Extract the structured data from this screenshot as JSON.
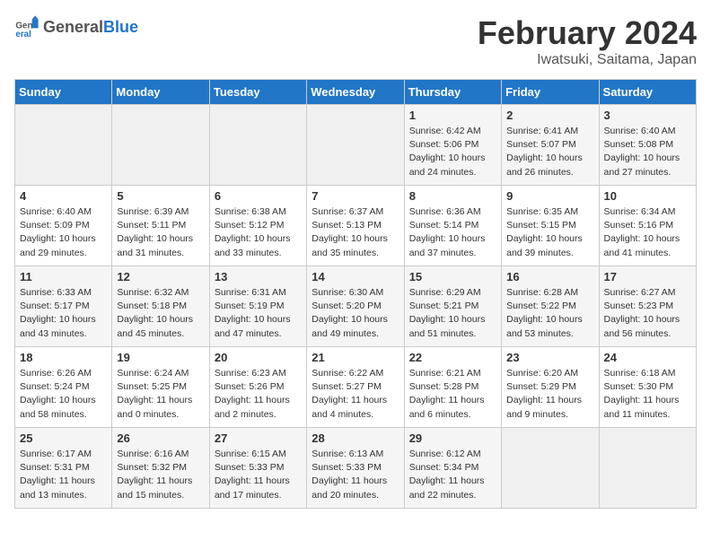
{
  "header": {
    "logo_general": "General",
    "logo_blue": "Blue",
    "month_year": "February 2024",
    "location": "Iwatsuki, Saitama, Japan"
  },
  "days_of_week": [
    "Sunday",
    "Monday",
    "Tuesday",
    "Wednesday",
    "Thursday",
    "Friday",
    "Saturday"
  ],
  "weeks": [
    [
      {
        "day": "",
        "info": ""
      },
      {
        "day": "",
        "info": ""
      },
      {
        "day": "",
        "info": ""
      },
      {
        "day": "",
        "info": ""
      },
      {
        "day": "1",
        "info": "Sunrise: 6:42 AM\nSunset: 5:06 PM\nDaylight: 10 hours\nand 24 minutes."
      },
      {
        "day": "2",
        "info": "Sunrise: 6:41 AM\nSunset: 5:07 PM\nDaylight: 10 hours\nand 26 minutes."
      },
      {
        "day": "3",
        "info": "Sunrise: 6:40 AM\nSunset: 5:08 PM\nDaylight: 10 hours\nand 27 minutes."
      }
    ],
    [
      {
        "day": "4",
        "info": "Sunrise: 6:40 AM\nSunset: 5:09 PM\nDaylight: 10 hours\nand 29 minutes."
      },
      {
        "day": "5",
        "info": "Sunrise: 6:39 AM\nSunset: 5:11 PM\nDaylight: 10 hours\nand 31 minutes."
      },
      {
        "day": "6",
        "info": "Sunrise: 6:38 AM\nSunset: 5:12 PM\nDaylight: 10 hours\nand 33 minutes."
      },
      {
        "day": "7",
        "info": "Sunrise: 6:37 AM\nSunset: 5:13 PM\nDaylight: 10 hours\nand 35 minutes."
      },
      {
        "day": "8",
        "info": "Sunrise: 6:36 AM\nSunset: 5:14 PM\nDaylight: 10 hours\nand 37 minutes."
      },
      {
        "day": "9",
        "info": "Sunrise: 6:35 AM\nSunset: 5:15 PM\nDaylight: 10 hours\nand 39 minutes."
      },
      {
        "day": "10",
        "info": "Sunrise: 6:34 AM\nSunset: 5:16 PM\nDaylight: 10 hours\nand 41 minutes."
      }
    ],
    [
      {
        "day": "11",
        "info": "Sunrise: 6:33 AM\nSunset: 5:17 PM\nDaylight: 10 hours\nand 43 minutes."
      },
      {
        "day": "12",
        "info": "Sunrise: 6:32 AM\nSunset: 5:18 PM\nDaylight: 10 hours\nand 45 minutes."
      },
      {
        "day": "13",
        "info": "Sunrise: 6:31 AM\nSunset: 5:19 PM\nDaylight: 10 hours\nand 47 minutes."
      },
      {
        "day": "14",
        "info": "Sunrise: 6:30 AM\nSunset: 5:20 PM\nDaylight: 10 hours\nand 49 minutes."
      },
      {
        "day": "15",
        "info": "Sunrise: 6:29 AM\nSunset: 5:21 PM\nDaylight: 10 hours\nand 51 minutes."
      },
      {
        "day": "16",
        "info": "Sunrise: 6:28 AM\nSunset: 5:22 PM\nDaylight: 10 hours\nand 53 minutes."
      },
      {
        "day": "17",
        "info": "Sunrise: 6:27 AM\nSunset: 5:23 PM\nDaylight: 10 hours\nand 56 minutes."
      }
    ],
    [
      {
        "day": "18",
        "info": "Sunrise: 6:26 AM\nSunset: 5:24 PM\nDaylight: 10 hours\nand 58 minutes."
      },
      {
        "day": "19",
        "info": "Sunrise: 6:24 AM\nSunset: 5:25 PM\nDaylight: 11 hours\nand 0 minutes."
      },
      {
        "day": "20",
        "info": "Sunrise: 6:23 AM\nSunset: 5:26 PM\nDaylight: 11 hours\nand 2 minutes."
      },
      {
        "day": "21",
        "info": "Sunrise: 6:22 AM\nSunset: 5:27 PM\nDaylight: 11 hours\nand 4 minutes."
      },
      {
        "day": "22",
        "info": "Sunrise: 6:21 AM\nSunset: 5:28 PM\nDaylight: 11 hours\nand 6 minutes."
      },
      {
        "day": "23",
        "info": "Sunrise: 6:20 AM\nSunset: 5:29 PM\nDaylight: 11 hours\nand 9 minutes."
      },
      {
        "day": "24",
        "info": "Sunrise: 6:18 AM\nSunset: 5:30 PM\nDaylight: 11 hours\nand 11 minutes."
      }
    ],
    [
      {
        "day": "25",
        "info": "Sunrise: 6:17 AM\nSunset: 5:31 PM\nDaylight: 11 hours\nand 13 minutes."
      },
      {
        "day": "26",
        "info": "Sunrise: 6:16 AM\nSunset: 5:32 PM\nDaylight: 11 hours\nand 15 minutes."
      },
      {
        "day": "27",
        "info": "Sunrise: 6:15 AM\nSunset: 5:33 PM\nDaylight: 11 hours\nand 17 minutes."
      },
      {
        "day": "28",
        "info": "Sunrise: 6:13 AM\nSunset: 5:33 PM\nDaylight: 11 hours\nand 20 minutes."
      },
      {
        "day": "29",
        "info": "Sunrise: 6:12 AM\nSunset: 5:34 PM\nDaylight: 11 hours\nand 22 minutes."
      },
      {
        "day": "",
        "info": ""
      },
      {
        "day": "",
        "info": ""
      }
    ]
  ]
}
